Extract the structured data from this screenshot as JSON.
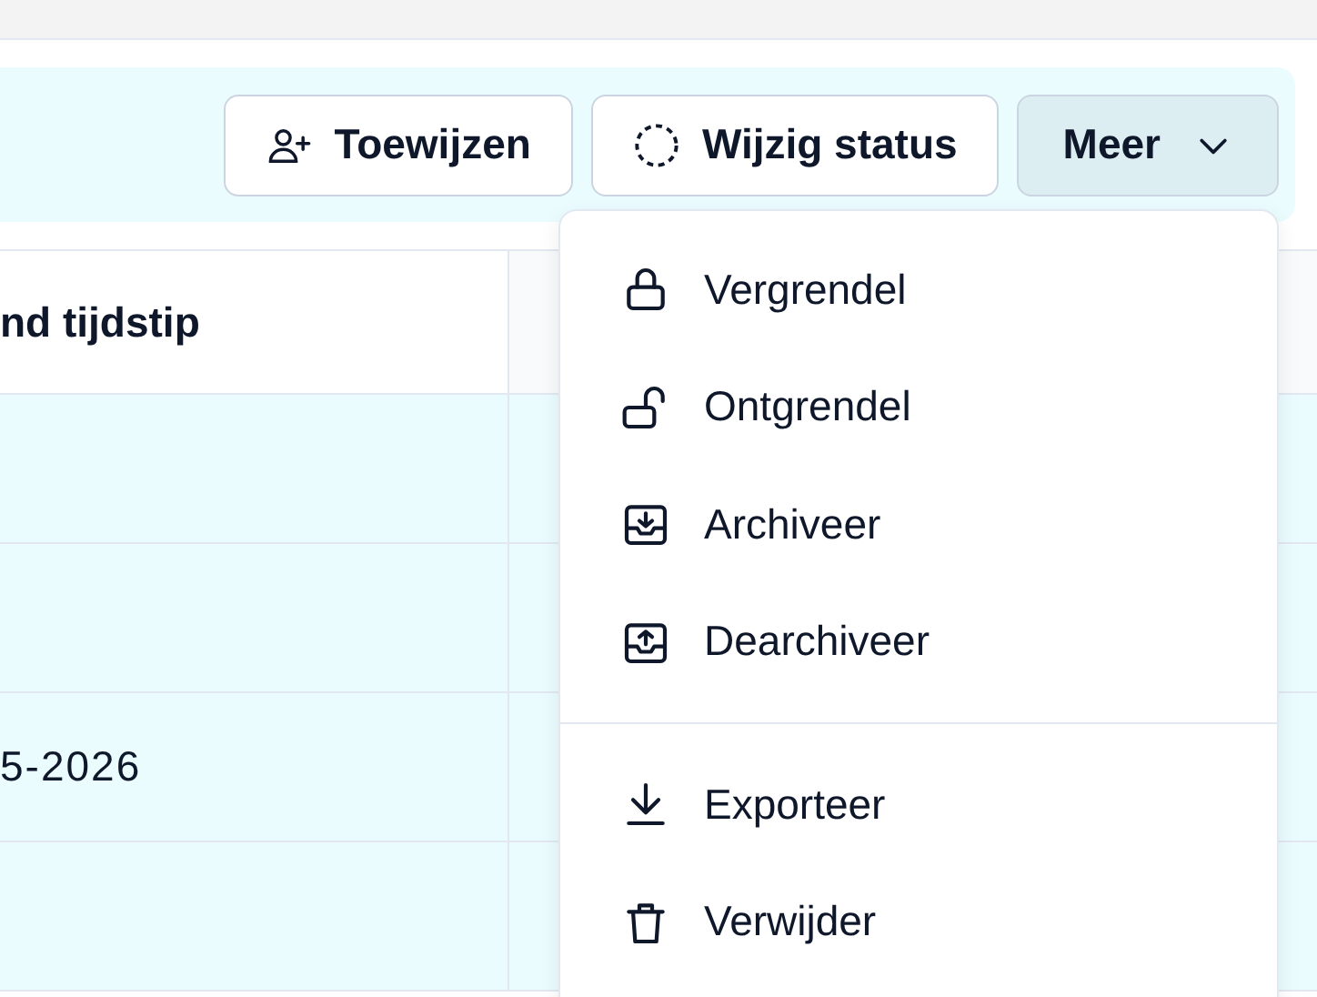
{
  "toolbar": {
    "buttons": [
      {
        "kind": "assign",
        "label": "Toewijzen"
      },
      {
        "kind": "status",
        "label": "Wijzig status"
      },
      {
        "kind": "more",
        "label": "Meer",
        "expanded": true
      }
    ]
  },
  "table": {
    "columns": [
      "nd tijdstip"
    ],
    "rows": [
      {
        "cells": [
          ""
        ]
      },
      {
        "cells": [
          ""
        ]
      },
      {
        "cells": [
          "5-2026"
        ]
      },
      {
        "cells": [
          ""
        ]
      }
    ]
  },
  "menu": {
    "groups": [
      [
        {
          "kind": "lock",
          "label": "Vergrendel"
        },
        {
          "kind": "unlock",
          "label": "Ontgrendel"
        },
        {
          "kind": "archive",
          "label": "Archiveer"
        },
        {
          "kind": "unarchive",
          "label": "Dearchiveer"
        }
      ],
      [
        {
          "kind": "export",
          "label": "Exporteer"
        },
        {
          "kind": "delete",
          "label": "Verwijder"
        }
      ]
    ]
  }
}
